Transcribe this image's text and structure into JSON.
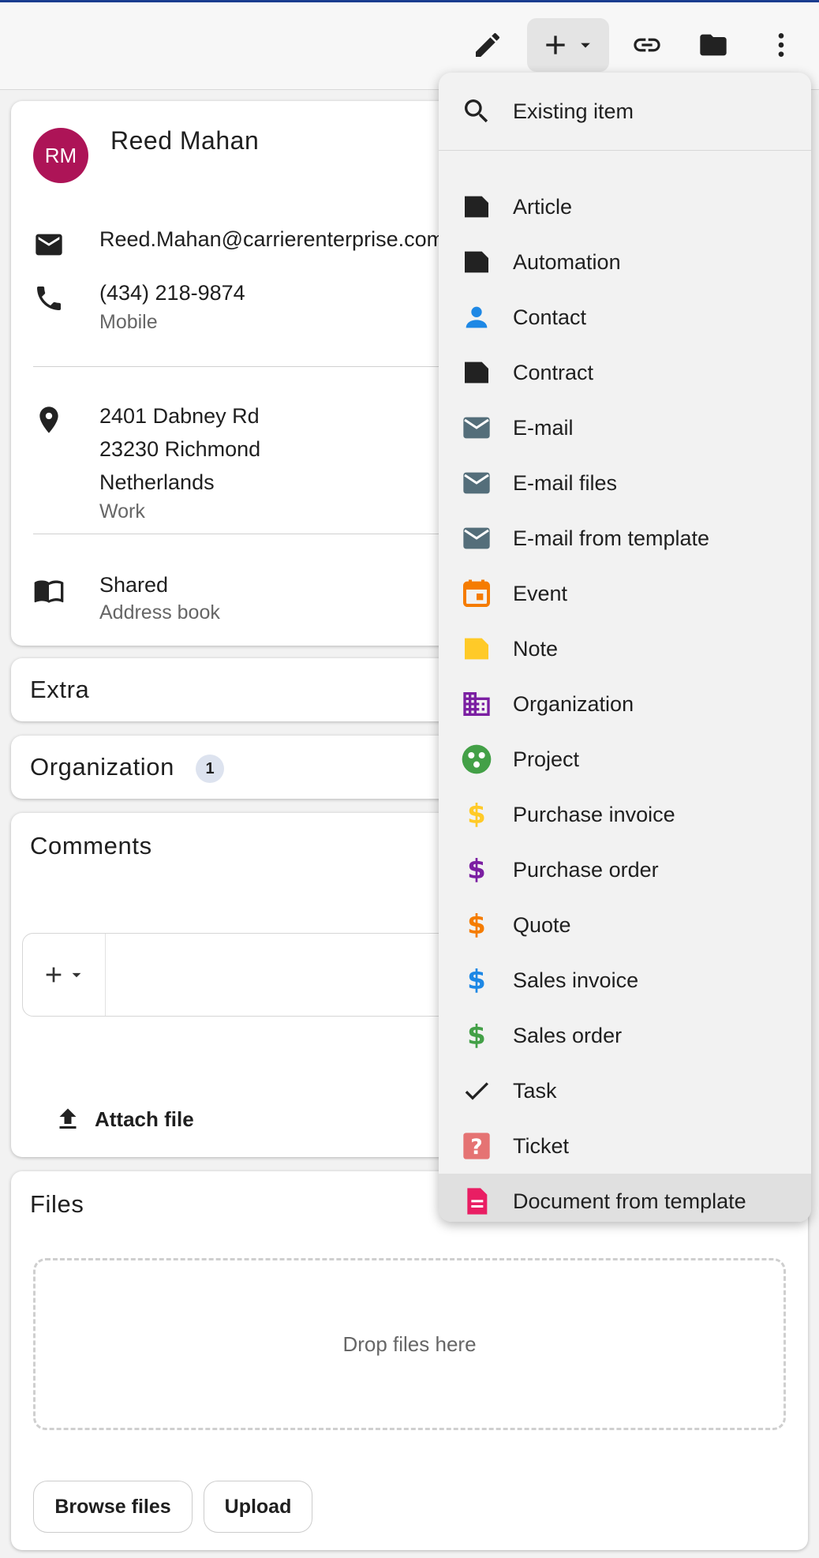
{
  "toolbar": {
    "edit_icon": "pencil-icon",
    "add_icon": "plus-icon",
    "link_icon": "link-icon",
    "folder_icon": "folder-icon",
    "more_icon": "more-vert-icon"
  },
  "contact": {
    "initials": "RM",
    "avatar_color": "#ad1457",
    "name": "Reed Mahan",
    "email": "Reed.Mahan@carrierenterprise.com",
    "phone": "(434) 218-9874",
    "phone_type": "Mobile",
    "address_line1": "2401 Dabney Rd",
    "address_line2": "23230 Richmond",
    "address_line3": "Netherlands",
    "address_type": "Work",
    "addressbook": "Shared",
    "addressbook_label": "Address book"
  },
  "sections": {
    "extra": "Extra",
    "organization": "Organization",
    "organization_count": "1",
    "comments": "Comments",
    "attach_file": "Attach file",
    "files": "Files",
    "drop_files": "Drop files here",
    "browse_files": "Browse files",
    "upload": "Upload"
  },
  "menu": {
    "existing_item": "Existing item",
    "items": [
      {
        "label": "Article",
        "icon": "article-icon",
        "color": "#222222"
      },
      {
        "label": "Automation",
        "icon": "automation-icon",
        "color": "#222222"
      },
      {
        "label": "Contact",
        "icon": "contact-icon",
        "color": "#1e88e5"
      },
      {
        "label": "Contract",
        "icon": "contract-icon",
        "color": "#222222"
      },
      {
        "label": "E-mail",
        "icon": "email-icon",
        "color": "#546e7a"
      },
      {
        "label": "E-mail files",
        "icon": "email-files-icon",
        "color": "#546e7a"
      },
      {
        "label": "E-mail from template",
        "icon": "email-template-icon",
        "color": "#546e7a"
      },
      {
        "label": "Event",
        "icon": "event-icon",
        "color": "#f57c00"
      },
      {
        "label": "Note",
        "icon": "note-icon",
        "color": "#ffca28"
      },
      {
        "label": "Organization",
        "icon": "organization-icon",
        "color": "#7b1fa2"
      },
      {
        "label": "Project",
        "icon": "project-icon",
        "color": "#43a047"
      },
      {
        "label": "Purchase invoice",
        "icon": "purchase-invoice-icon",
        "color": "#ffca28"
      },
      {
        "label": "Purchase order",
        "icon": "purchase-order-icon",
        "color": "#7b1fa2"
      },
      {
        "label": "Quote",
        "icon": "quote-icon",
        "color": "#f57c00"
      },
      {
        "label": "Sales invoice",
        "icon": "sales-invoice-icon",
        "color": "#1e88e5"
      },
      {
        "label": "Sales order",
        "icon": "sales-order-icon",
        "color": "#43a047"
      },
      {
        "label": "Task",
        "icon": "task-icon",
        "color": "#222222"
      },
      {
        "label": "Ticket",
        "icon": "ticket-icon",
        "color": "#e57373"
      },
      {
        "label": "Document from template",
        "icon": "document-template-icon",
        "color": "#e91e63"
      }
    ]
  }
}
